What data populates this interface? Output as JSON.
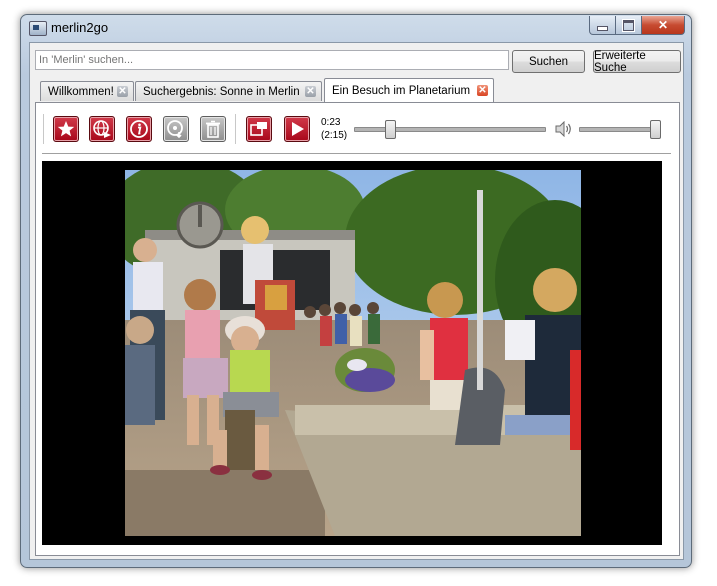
{
  "window": {
    "title": "merlin2go"
  },
  "search": {
    "placeholder": "In 'Merlin' suchen...",
    "value": ""
  },
  "buttons": {
    "search": "Suchen",
    "advanced_search": "Erweiterte Suche"
  },
  "tabs": [
    {
      "label": "Willkommen!",
      "active": false
    },
    {
      "label": "Suchergebnis: Sonne in Merlin",
      "active": false
    },
    {
      "label": "Ein Besuch im Planetarium",
      "active": true
    }
  ],
  "toolbar": {
    "icons": [
      "favorite-star-icon",
      "web-export-icon",
      "info-icon",
      "save-disc-icon",
      "trash-icon",
      "fullscreen-icon",
      "play-icon"
    ]
  },
  "player": {
    "current_time": "0:23",
    "duration": "(2:15)",
    "progress_fraction": 0.17,
    "volume_fraction": 1.0
  },
  "colors": {
    "accent_red": "#b01020",
    "close_red": "#c74b31"
  }
}
